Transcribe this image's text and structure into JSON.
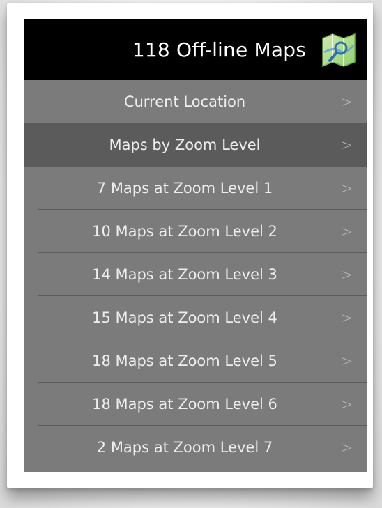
{
  "header": {
    "title": "118 Off-line Maps",
    "icon": "maps-app-icon"
  },
  "menu": {
    "current_location": "Current Location",
    "section_label": "Maps by Zoom Level",
    "items": [
      {
        "label": "7 Maps at Zoom Level 1"
      },
      {
        "label": "10 Maps at Zoom Level 2"
      },
      {
        "label": "14 Maps at Zoom Level 3"
      },
      {
        "label": "15 Maps at Zoom Level 4"
      },
      {
        "label": "18 Maps at Zoom Level 5"
      },
      {
        "label": "18 Maps at Zoom Level 6"
      },
      {
        "label": "2 Maps at Zoom Level 7"
      }
    ],
    "chevron": ">"
  },
  "colors": {
    "header_bg": "#000000",
    "row_bg": "#7b7b7b",
    "section_bg": "#5b5b5b",
    "text": "#eeeeee",
    "chevron": "#bdbdbd"
  }
}
